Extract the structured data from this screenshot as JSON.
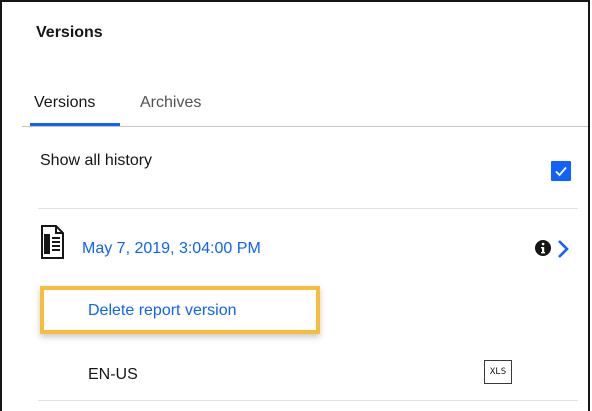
{
  "panel": {
    "title": "Versions"
  },
  "tabs": [
    {
      "label": "Versions",
      "selected": true
    },
    {
      "label": "Archives",
      "selected": false
    }
  ],
  "history": {
    "label": "Show all history",
    "checked": true
  },
  "version": {
    "date": "May 7, 2019, 3:04:00 PM",
    "icon": "report-document-icon"
  },
  "actions": {
    "delete_label": "Delete report version"
  },
  "output": {
    "locale": "EN-US",
    "format": "XLS"
  },
  "colors": {
    "accent": "#0f62fe",
    "highlight": "#f6be3b",
    "text": "#161616"
  }
}
